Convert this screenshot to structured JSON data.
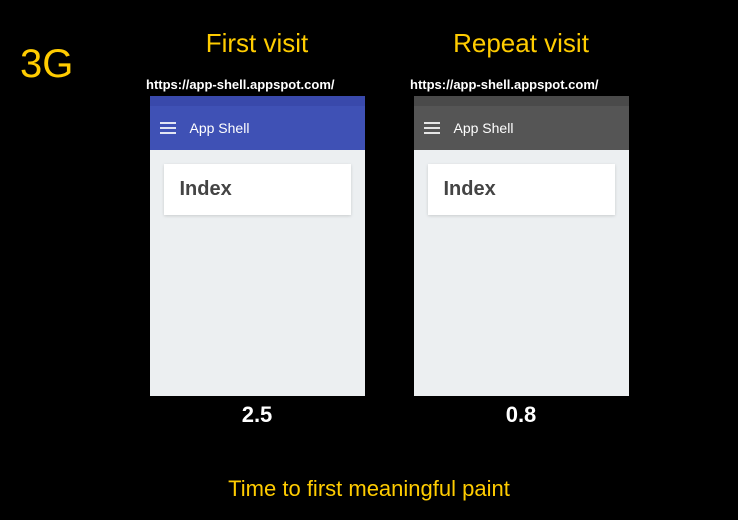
{
  "network_label": "3G",
  "caption": "Time to first meaningful paint",
  "columns": [
    {
      "title": "First visit",
      "url": "https://app-shell.appspot.com/",
      "app_bar_title": "App Shell",
      "card_title": "Index",
      "timing": "2.5",
      "theme": "blue"
    },
    {
      "title": "Repeat visit",
      "url": "https://app-shell.appspot.com/",
      "app_bar_title": "App Shell",
      "card_title": "Index",
      "timing": "0.8",
      "theme": "gray"
    }
  ]
}
